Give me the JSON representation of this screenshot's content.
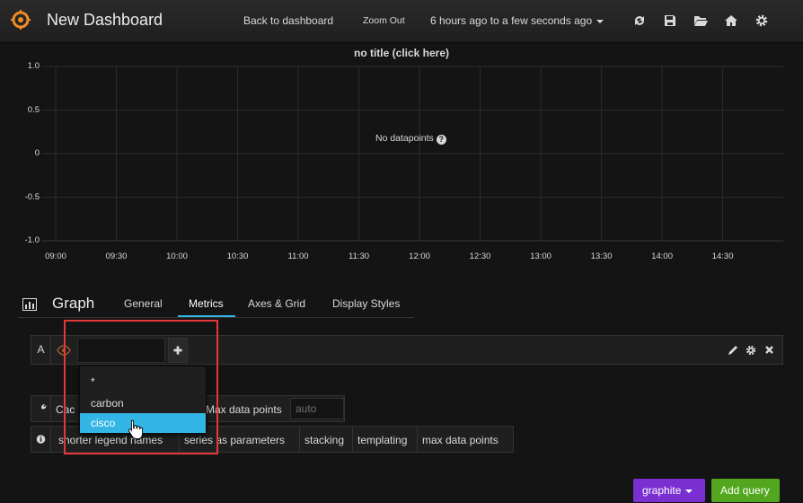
{
  "navbar": {
    "title": "New Dashboard",
    "back_label": "Back to dashboard",
    "zoom_label": "Zoom Out",
    "time_range": "6 hours ago to a few seconds ago",
    "icons": [
      "refresh-icon",
      "save-icon",
      "folder-open-icon",
      "home-icon",
      "gear-icon"
    ]
  },
  "panel": {
    "title": "no title (click here)",
    "no_data_text": "No datapoints"
  },
  "chart_data": {
    "type": "line",
    "title": "no title (click here)",
    "x_ticks": [
      "09:00",
      "09:30",
      "10:00",
      "10:30",
      "11:00",
      "11:30",
      "12:00",
      "12:30",
      "13:00",
      "13:30",
      "14:00",
      "14:30"
    ],
    "y_ticks": [
      "1.0",
      "0.5",
      "0",
      "-0.5",
      "-1.0"
    ],
    "ylim": [
      -1.0,
      1.0
    ],
    "series": [],
    "grid": true
  },
  "editor": {
    "title": "Graph",
    "tabs": [
      {
        "label": "General"
      },
      {
        "label": "Metrics"
      },
      {
        "label": "Axes & Grid"
      },
      {
        "label": "Display Styles"
      }
    ],
    "active_tab": "Metrics"
  },
  "query": {
    "ref_id": "A",
    "input_value": "",
    "segment_options": [
      "*",
      "carbon",
      "cisco"
    ],
    "highlighted_option": "cisco"
  },
  "options": {
    "row1": {
      "cache_label": "Cac",
      "max_points_label": "Max data points",
      "max_points_placeholder": "auto"
    },
    "row2": {
      "items": [
        "shorter legend names",
        "series as parameters",
        "stacking",
        "templating",
        "max data points"
      ]
    }
  },
  "footer": {
    "datasource_label": "graphite",
    "add_query_label": "Add query"
  },
  "colors": {
    "accent": "#33b5e5",
    "highlight": "#e23838",
    "datasource_button": "#7a2fd1",
    "add_button": "#52a71f"
  }
}
